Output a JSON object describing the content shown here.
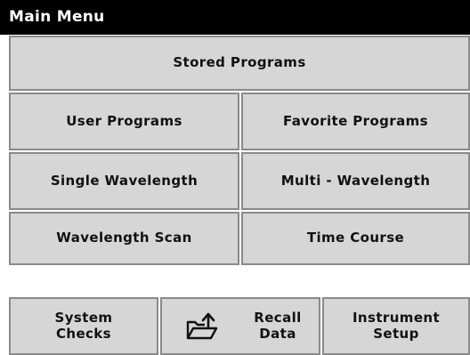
{
  "title": "Main Menu",
  "menu": {
    "stored_programs": "Stored Programs",
    "user_programs": "User Programs",
    "favorite_programs": "Favorite Programs",
    "single_wavelength": "Single Wavelength",
    "multi_wavelength": "Multi - Wavelength",
    "wavelength_scan": "Wavelength Scan",
    "time_course": "Time Course"
  },
  "bottom": {
    "system_checks": "System\nChecks",
    "recall_data": "Recall\nData",
    "instrument_setup": "Instrument\nSetup",
    "recall_icon": "folder-export-icon"
  },
  "colors": {
    "title_bar": "#000000",
    "button_fill": "#d6d6d6",
    "button_border": "#8a8a8a"
  }
}
